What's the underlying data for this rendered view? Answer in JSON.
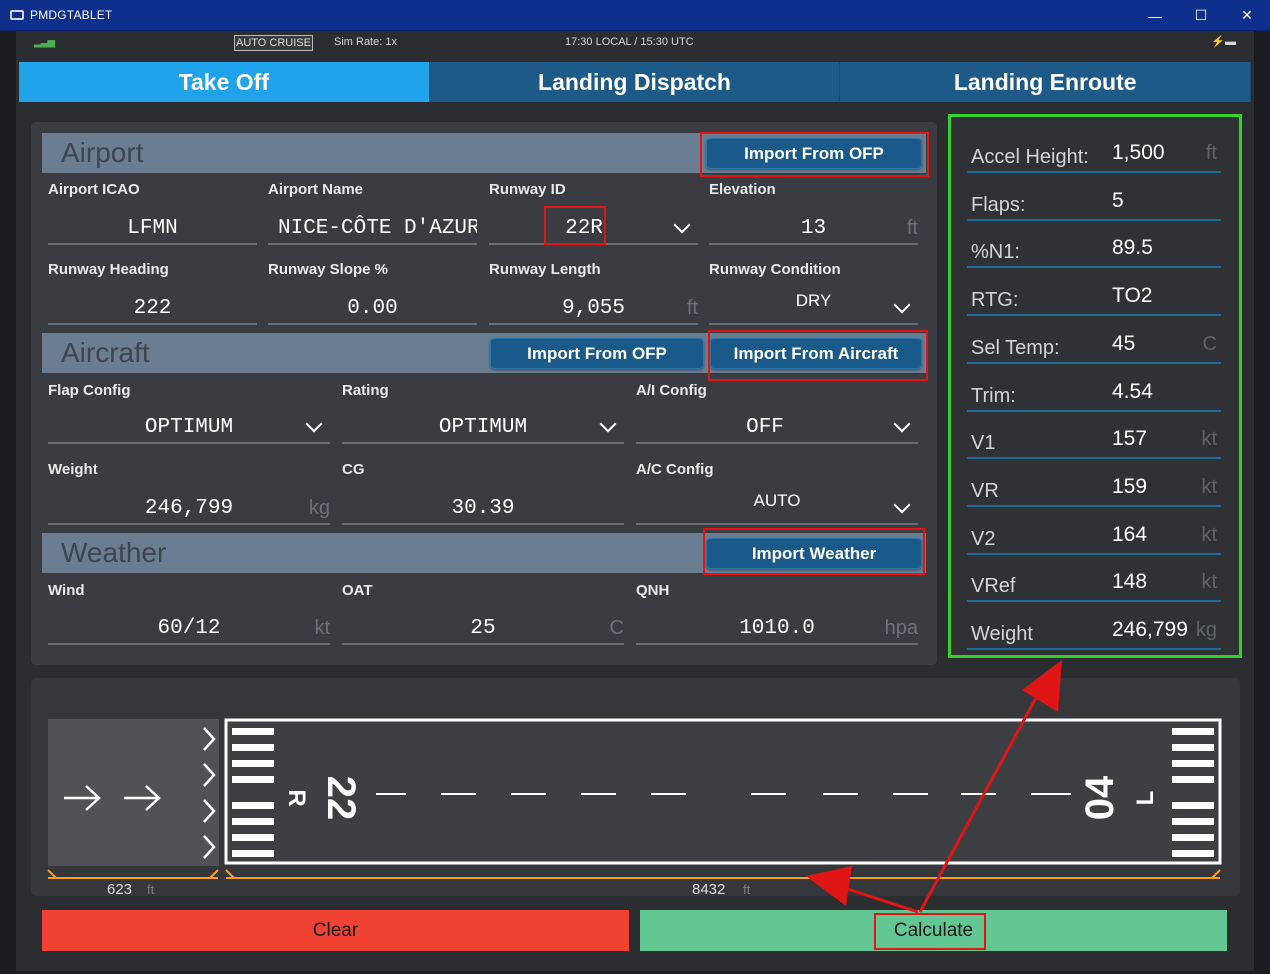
{
  "window": {
    "title": "PMDGTABLET",
    "minimize": "—",
    "maximize": "☐",
    "close": "✕"
  },
  "status": {
    "signal": "▂▃▅",
    "auto_cruise": "AUTO CRUISE",
    "sim_rate": "Sim Rate: 1x",
    "clock": "17:30 LOCAL / 15:30 UTC",
    "battery": "⚡▬"
  },
  "tabs": [
    {
      "label": "Take Off",
      "active": true
    },
    {
      "label": "Landing Dispatch",
      "active": false
    },
    {
      "label": "Landing Enroute",
      "active": false
    }
  ],
  "airport": {
    "title": "Airport",
    "import_ofp": "Import From OFP",
    "icao_label": "Airport ICAO",
    "icao": "LFMN",
    "name_label": "Airport Name",
    "name": "NICE-CÔTE D'AZUR",
    "runway_label": "Runway ID",
    "runway": "22R",
    "elev_label": "Elevation",
    "elev": "13",
    "elev_unit": "ft",
    "heading_label": "Runway Heading",
    "heading": "222",
    "slope_label": "Runway Slope %",
    "slope": "0.00",
    "length_label": "Runway Length",
    "length": "9,055",
    "length_unit": "ft",
    "cond_label": "Runway Condition",
    "cond": "DRY"
  },
  "aircraft": {
    "title": "Aircraft",
    "import_ofp": "Import From OFP",
    "import_aircraft": "Import From Aircraft",
    "flap_label": "Flap Config",
    "flap": "OPTIMUM",
    "rating_label": "Rating",
    "rating": "OPTIMUM",
    "ai_label": "A/I Config",
    "ai": "OFF",
    "weight_label": "Weight",
    "weight": "246,799",
    "weight_unit": "kg",
    "cg_label": "CG",
    "cg": "30.39",
    "ac_label": "A/C Config",
    "ac": "AUTO"
  },
  "weather": {
    "title": "Weather",
    "import": "Import Weather",
    "wind_label": "Wind",
    "wind": "60/12",
    "wind_unit": "kt",
    "oat_label": "OAT",
    "oat": "25",
    "oat_unit": "C",
    "qnh_label": "QNH",
    "qnh": "1010.0",
    "qnh_unit": "hpa"
  },
  "results": [
    {
      "label": "Accel Height:",
      "value": "1,500",
      "unit": "ft"
    },
    {
      "label": "Flaps:",
      "value": "5",
      "unit": ""
    },
    {
      "label": "%N1:",
      "value": "89.5",
      "unit": ""
    },
    {
      "label": "RTG:",
      "value": "TO2",
      "unit": ""
    },
    {
      "label": "Sel Temp:",
      "value": "45",
      "unit": "C"
    },
    {
      "label": "Trim:",
      "value": "4.54",
      "unit": ""
    },
    {
      "label": "V1",
      "value": "157",
      "unit": "kt"
    },
    {
      "label": "VR",
      "value": "159",
      "unit": "kt"
    },
    {
      "label": "V2",
      "value": "164",
      "unit": "kt"
    },
    {
      "label": "VRef",
      "value": "148",
      "unit": "kt"
    },
    {
      "label": "Weight",
      "value": "246,799",
      "unit": "kg"
    }
  ],
  "runway_viz": {
    "end_a": "22",
    "end_a_side": "R",
    "end_b": "04",
    "end_b_side": "L",
    "offset": "623",
    "offset_unit": "ft",
    "length": "8432",
    "length_unit": "ft"
  },
  "actions": {
    "clear": "Clear",
    "calculate": "Calculate"
  },
  "colors": {
    "active_tab": "#21a3eb",
    "tab_bg": "#1e5a88",
    "clear": "#ef4233",
    "calculate": "#62c792",
    "highlight_red": "#e01515",
    "highlight_green": "#33d12a",
    "runway_progress": "#f5a020"
  }
}
